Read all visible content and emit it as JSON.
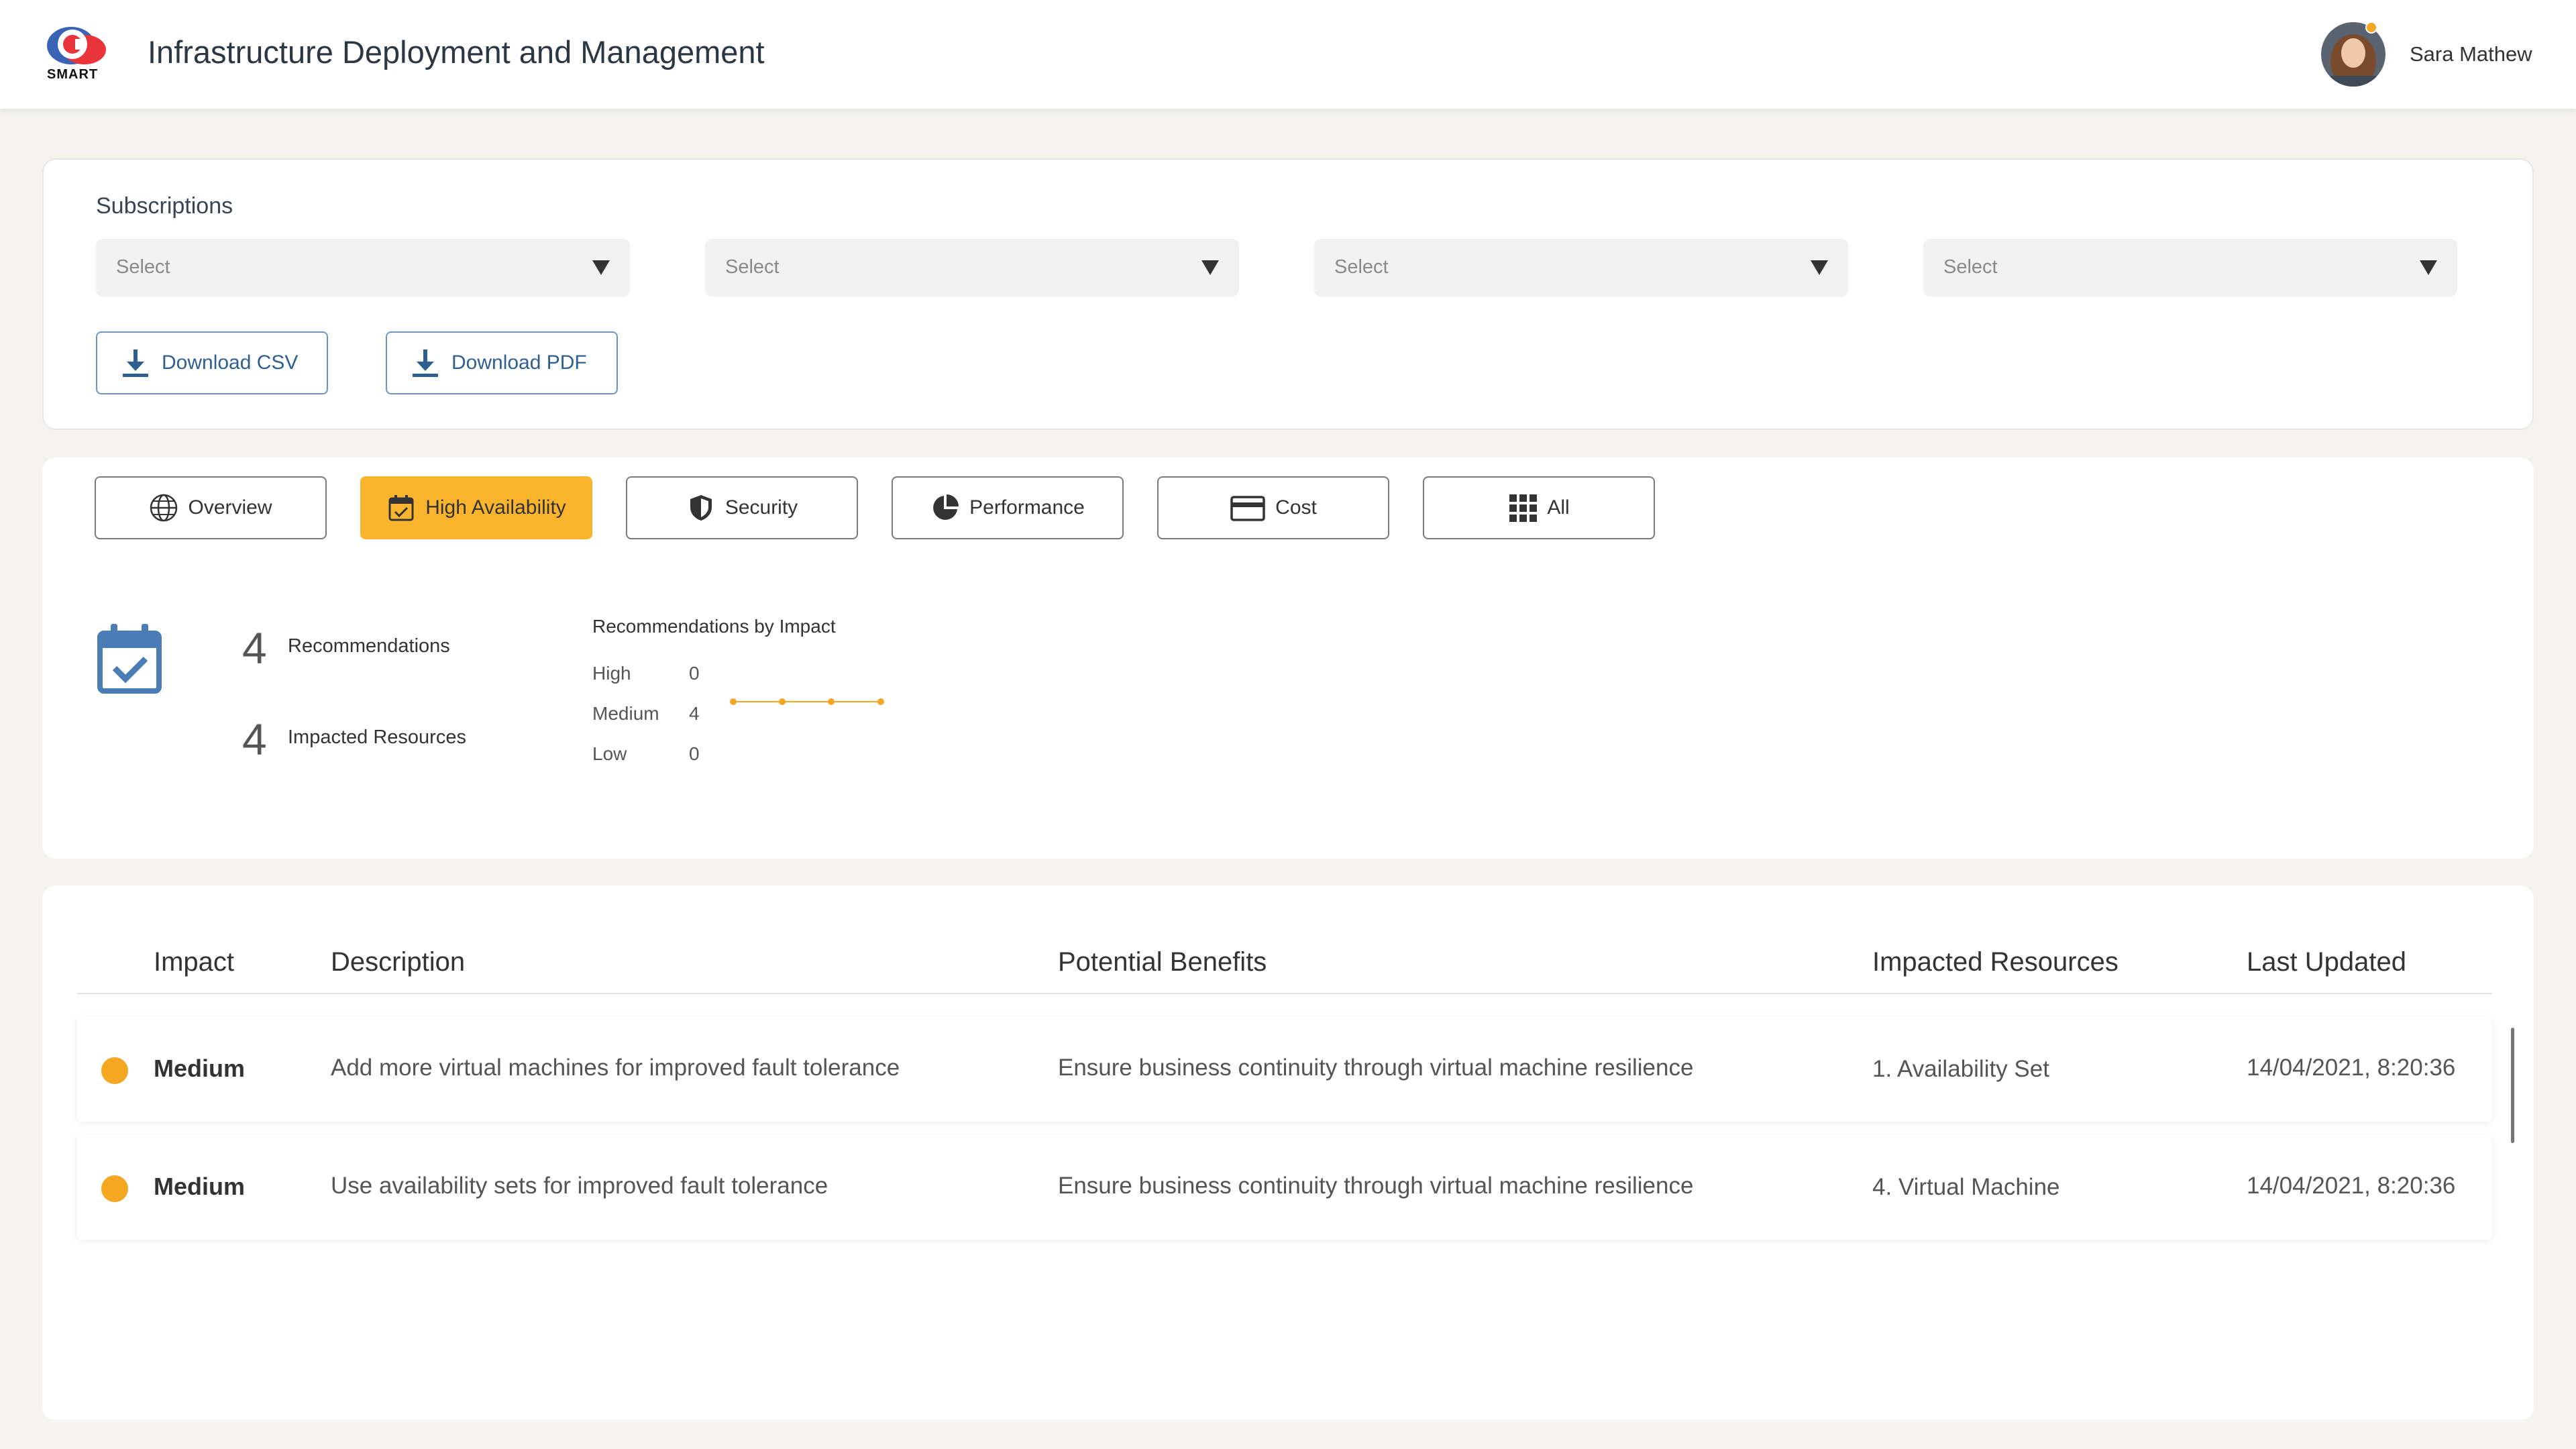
{
  "header": {
    "logo_text": "SMART",
    "title": "Infrastructure Deployment and Management",
    "user_name": "Sara Mathew"
  },
  "subscriptions": {
    "label": "Subscriptions",
    "selects": [
      {
        "placeholder": "Select"
      },
      {
        "placeholder": "Select"
      },
      {
        "placeholder": "Select"
      },
      {
        "placeholder": "Select"
      }
    ],
    "download_csv": "Download CSV",
    "download_pdf": "Download PDF"
  },
  "tabs": [
    {
      "label": "Overview",
      "icon": "globe-icon",
      "active": false
    },
    {
      "label": "High Availability",
      "icon": "calendar-check-icon",
      "active": true
    },
    {
      "label": "Security",
      "icon": "shield-icon",
      "active": false
    },
    {
      "label": "Performance",
      "icon": "pie-chart-icon",
      "active": false
    },
    {
      "label": "Cost",
      "icon": "credit-card-icon",
      "active": false
    },
    {
      "label": "All",
      "icon": "grid-icon",
      "active": false
    }
  ],
  "summary": {
    "recommendations_count": "4",
    "recommendations_label": "Recommendations",
    "impacted_count": "4",
    "impacted_label": "Impacted Resources",
    "impact_title": "Recommendations by Impact",
    "impact_rows": [
      {
        "label": "High",
        "value": "0"
      },
      {
        "label": "Medium",
        "value": "4"
      },
      {
        "label": "Low",
        "value": "0"
      }
    ]
  },
  "table": {
    "headers": {
      "impact": "Impact",
      "description": "Description",
      "benefits": "Potential Benefits",
      "resources": "Impacted Resources",
      "updated": "Last Updated"
    },
    "rows": [
      {
        "impact": "Medium",
        "description": "Add more virtual machines for improved fault tolerance",
        "benefits": "Ensure business continuity through virtual machine resilience",
        "resources": "1. Availability Set",
        "updated": "14/04/2021, 8:20:36"
      },
      {
        "impact": "Medium",
        "description": "Use availability sets for improved fault tolerance",
        "benefits": "Ensure business continuity through virtual machine resilience",
        "resources": "4. Virtual Machine",
        "updated": "14/04/2021, 8:20:36"
      }
    ]
  },
  "colors": {
    "accent": "#fbb42d",
    "medium_dot": "#f5a623",
    "link_blue": "#2f5f90",
    "icon_blue": "#4a7db5"
  }
}
